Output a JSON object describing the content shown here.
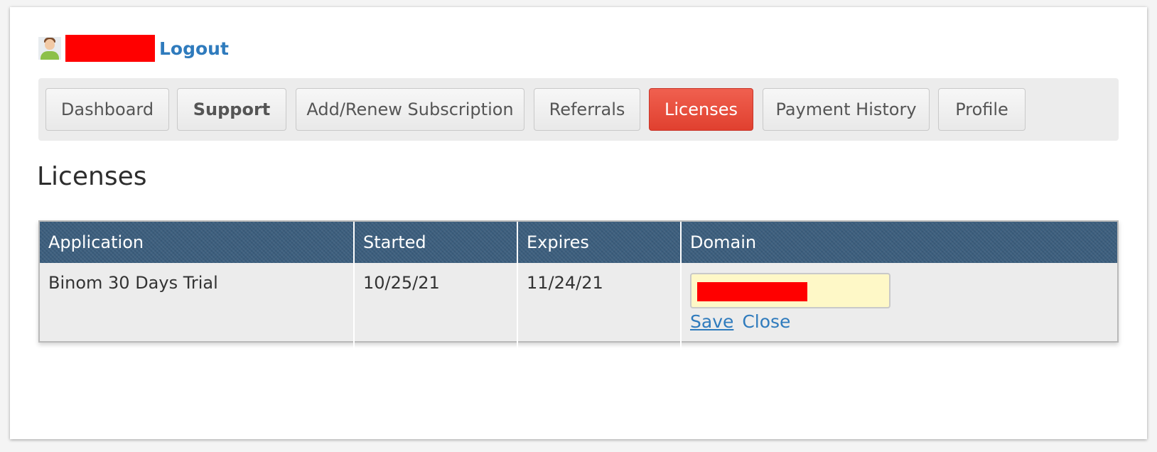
{
  "header": {
    "avatar_icon": "user-avatar-icon",
    "logout_label": "Logout",
    "redaction_color": "#ff0000"
  },
  "nav": {
    "items": [
      {
        "label": "Dashboard",
        "active": false,
        "bold": false
      },
      {
        "label": "Support",
        "active": false,
        "bold": true
      },
      {
        "label": "Add/Renew Subscription",
        "active": false,
        "bold": false
      },
      {
        "label": "Referrals",
        "active": false,
        "bold": false
      },
      {
        "label": "Licenses",
        "active": true,
        "bold": false
      },
      {
        "label": "Payment History",
        "active": false,
        "bold": false
      },
      {
        "label": "Profile",
        "active": false,
        "bold": false
      }
    ],
    "active_color": "#e8503f"
  },
  "page": {
    "title": "Licenses"
  },
  "table": {
    "columns": [
      "Application",
      "Started",
      "Expires",
      "Domain"
    ],
    "rows": [
      {
        "application": "Binom 30 Days Trial",
        "started": "10/25/21",
        "expires": "11/24/21",
        "domain_actions": {
          "save": "Save",
          "close": "Close"
        }
      }
    ],
    "header_color": "#3b5e7d"
  }
}
